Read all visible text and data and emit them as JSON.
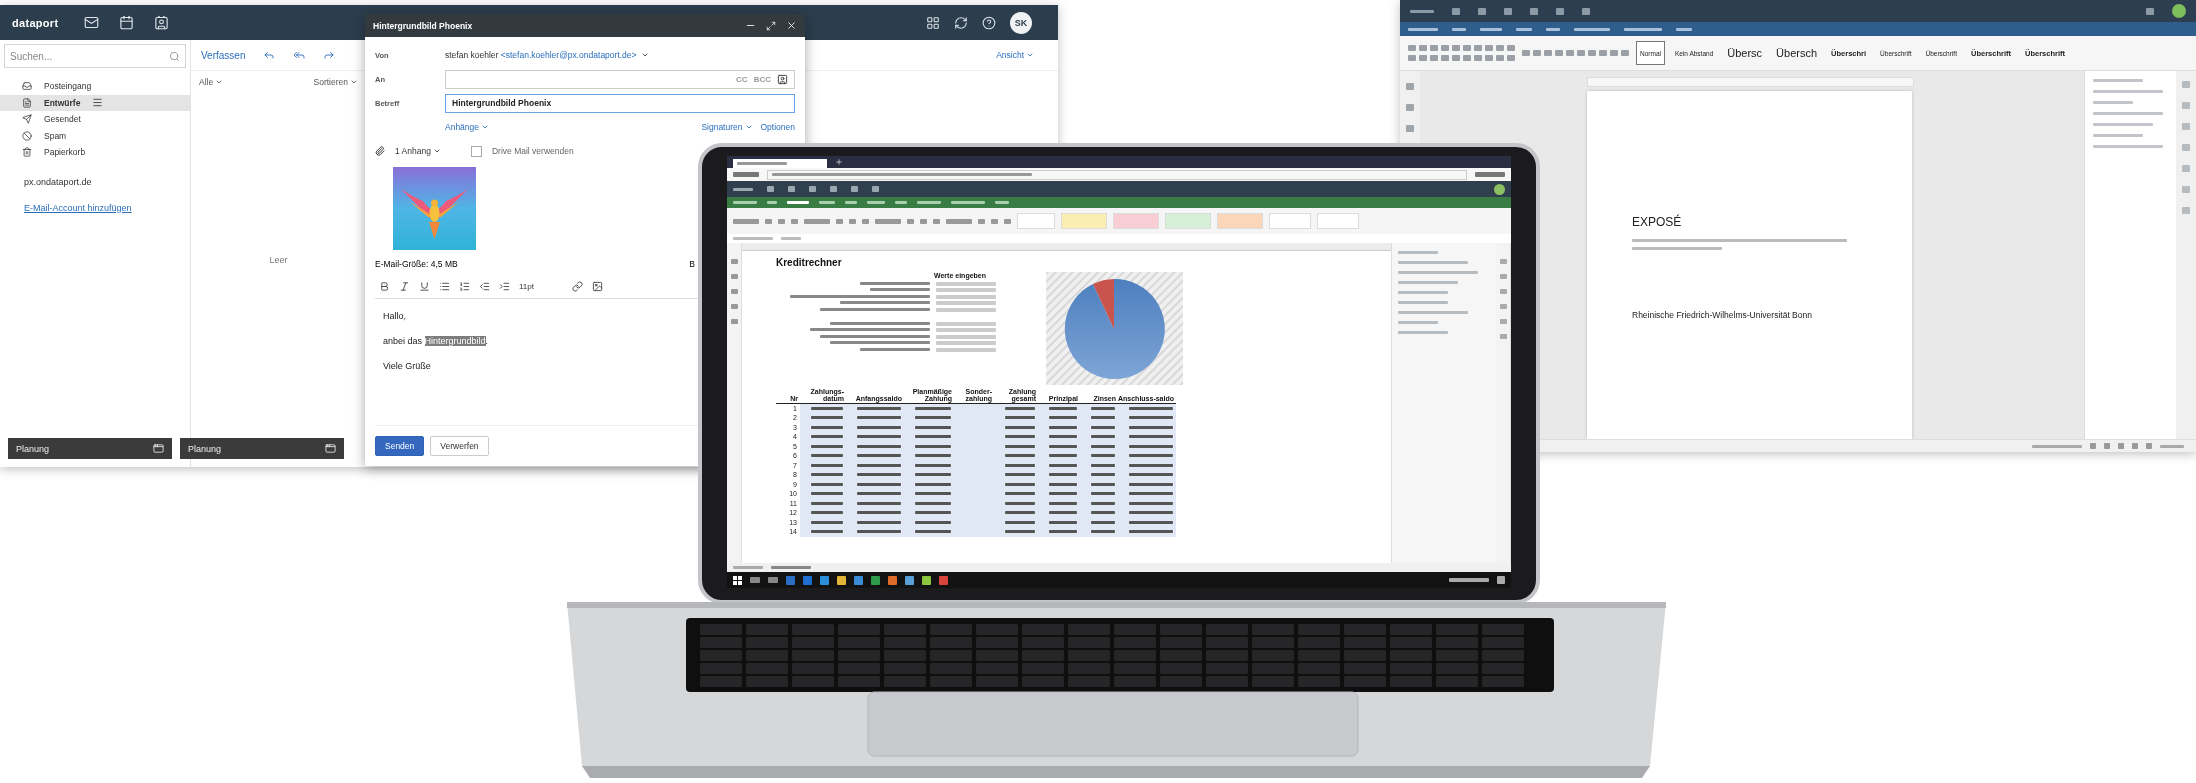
{
  "mail": {
    "logo": "dataport",
    "avatar": "SK",
    "search": {
      "placeholder": "Suchen..."
    },
    "toolbar": {
      "compose": "Verfassen",
      "filter": "Alle",
      "sort": "Sortieren",
      "view": "Ansicht"
    },
    "folders": [
      {
        "label": "Posteingang",
        "kind": "inbox",
        "selected": false
      },
      {
        "label": "Entwürfe",
        "kind": "drafts",
        "selected": true
      },
      {
        "label": "Gesendet",
        "kind": "sent",
        "selected": false
      },
      {
        "label": "Spam",
        "kind": "spam",
        "selected": false
      },
      {
        "label": "Papierkorb",
        "kind": "trash",
        "selected": false
      }
    ],
    "account": "px.ondataport.de",
    "add_account": "E-Mail-Account hinzufügen",
    "empty": "Leer",
    "docked": [
      {
        "title": "Planung"
      },
      {
        "title": "Planung"
      }
    ],
    "compose": {
      "title": "Hintergrundbild Phoenix",
      "from_label": "Von",
      "from_name": "stefan koehler",
      "from_address": "<stefan.koehler@px.ondataport.de>",
      "to_label": "An",
      "cc": "CC",
      "bcc": "BCC",
      "subject_label": "Betreff",
      "subject": "Hintergrundbild Phoenix",
      "attachments_menu": "Anhänge",
      "signatures_menu": "Signaturen",
      "options_menu": "Optionen",
      "attachment_count": "1 Anhang",
      "drive_mail": {
        "label": "Drive Mail verwenden",
        "checked": false
      },
      "size": "E-Mail-Größe: 4,5 MB",
      "size_side": "B",
      "font_size": "11pt",
      "body": [
        {
          "text": "Hallo,"
        },
        {
          "text": "anbei das ",
          "selection": "Hintergrundbild",
          "tail": "."
        },
        {
          "text": "Viele Grüße"
        }
      ],
      "send": "Senden",
      "discard": "Verwerfen"
    }
  },
  "writer": {
    "styles": [
      {
        "label": "Normal",
        "kind": "plain",
        "selected": true
      },
      {
        "label": "Kein Abstand",
        "kind": "plain",
        "selected": false
      },
      {
        "label": "Übersc",
        "kind": "large",
        "selected": false
      },
      {
        "label": "Übersch",
        "kind": "large",
        "selected": false
      },
      {
        "label": "Überschri",
        "kind": "heading",
        "selected": false
      },
      {
        "label": "Überschrift",
        "kind": "small",
        "selected": false
      },
      {
        "label": "Überschrift",
        "kind": "small",
        "selected": false
      },
      {
        "label": "Überschrift",
        "kind": "heading",
        "selected": false
      },
      {
        "label": "Überschrift",
        "kind": "heading",
        "selected": false
      }
    ],
    "document": {
      "title": "EXPOSÉ",
      "subtitle": "Rheinische Friedrich-Wilhelms-Universität Bonn"
    }
  },
  "sheet": {
    "title": "Kreditrechner",
    "input_header": "Werte eingeben",
    "columns": [
      "Nr",
      "Zahlungs-datum",
      "Anfangssaldo",
      "Planmäßige Zahlung",
      "Sonder-zahlung",
      "Zahlung gesamt",
      "Prinzipal",
      "Zinsen",
      "Anschluss-saldo"
    ],
    "row_numbers": [
      "1",
      "2",
      "3",
      "4",
      "5",
      "6",
      "7",
      "8",
      "9",
      "10",
      "11",
      "12",
      "13",
      "14"
    ]
  }
}
